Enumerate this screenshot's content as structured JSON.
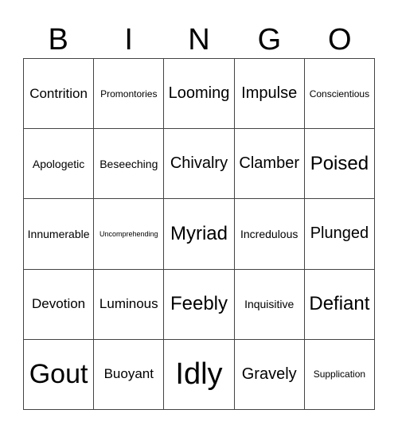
{
  "header": [
    "B",
    "I",
    "N",
    "G",
    "O"
  ],
  "cells": [
    {
      "text": "Contrition",
      "size": "m"
    },
    {
      "text": "Promontories",
      "size": "s"
    },
    {
      "text": "Looming",
      "size": "l"
    },
    {
      "text": "Impulse",
      "size": "l"
    },
    {
      "text": "Conscientious",
      "size": "s"
    },
    {
      "text": "Apologetic",
      "size": "sm"
    },
    {
      "text": "Beseeching",
      "size": "sm"
    },
    {
      "text": "Chivalry",
      "size": "l"
    },
    {
      "text": "Clamber",
      "size": "l"
    },
    {
      "text": "Poised",
      "size": "xl"
    },
    {
      "text": "Innumerable",
      "size": "sm"
    },
    {
      "text": "Uncomprehending",
      "size": "xs"
    },
    {
      "text": "Myriad",
      "size": "xl"
    },
    {
      "text": "Incredulous",
      "size": "sm"
    },
    {
      "text": "Plunged",
      "size": "l"
    },
    {
      "text": "Devotion",
      "size": "m"
    },
    {
      "text": "Luminous",
      "size": "m"
    },
    {
      "text": "Feebly",
      "size": "xl"
    },
    {
      "text": "Inquisitive",
      "size": "sm"
    },
    {
      "text": "Defiant",
      "size": "xl"
    },
    {
      "text": "Gout",
      "size": "xxl"
    },
    {
      "text": "Buoyant",
      "size": "m"
    },
    {
      "text": "Idly",
      "size": "xxxl"
    },
    {
      "text": "Gravely",
      "size": "l"
    },
    {
      "text": "Supplication",
      "size": "s"
    }
  ]
}
